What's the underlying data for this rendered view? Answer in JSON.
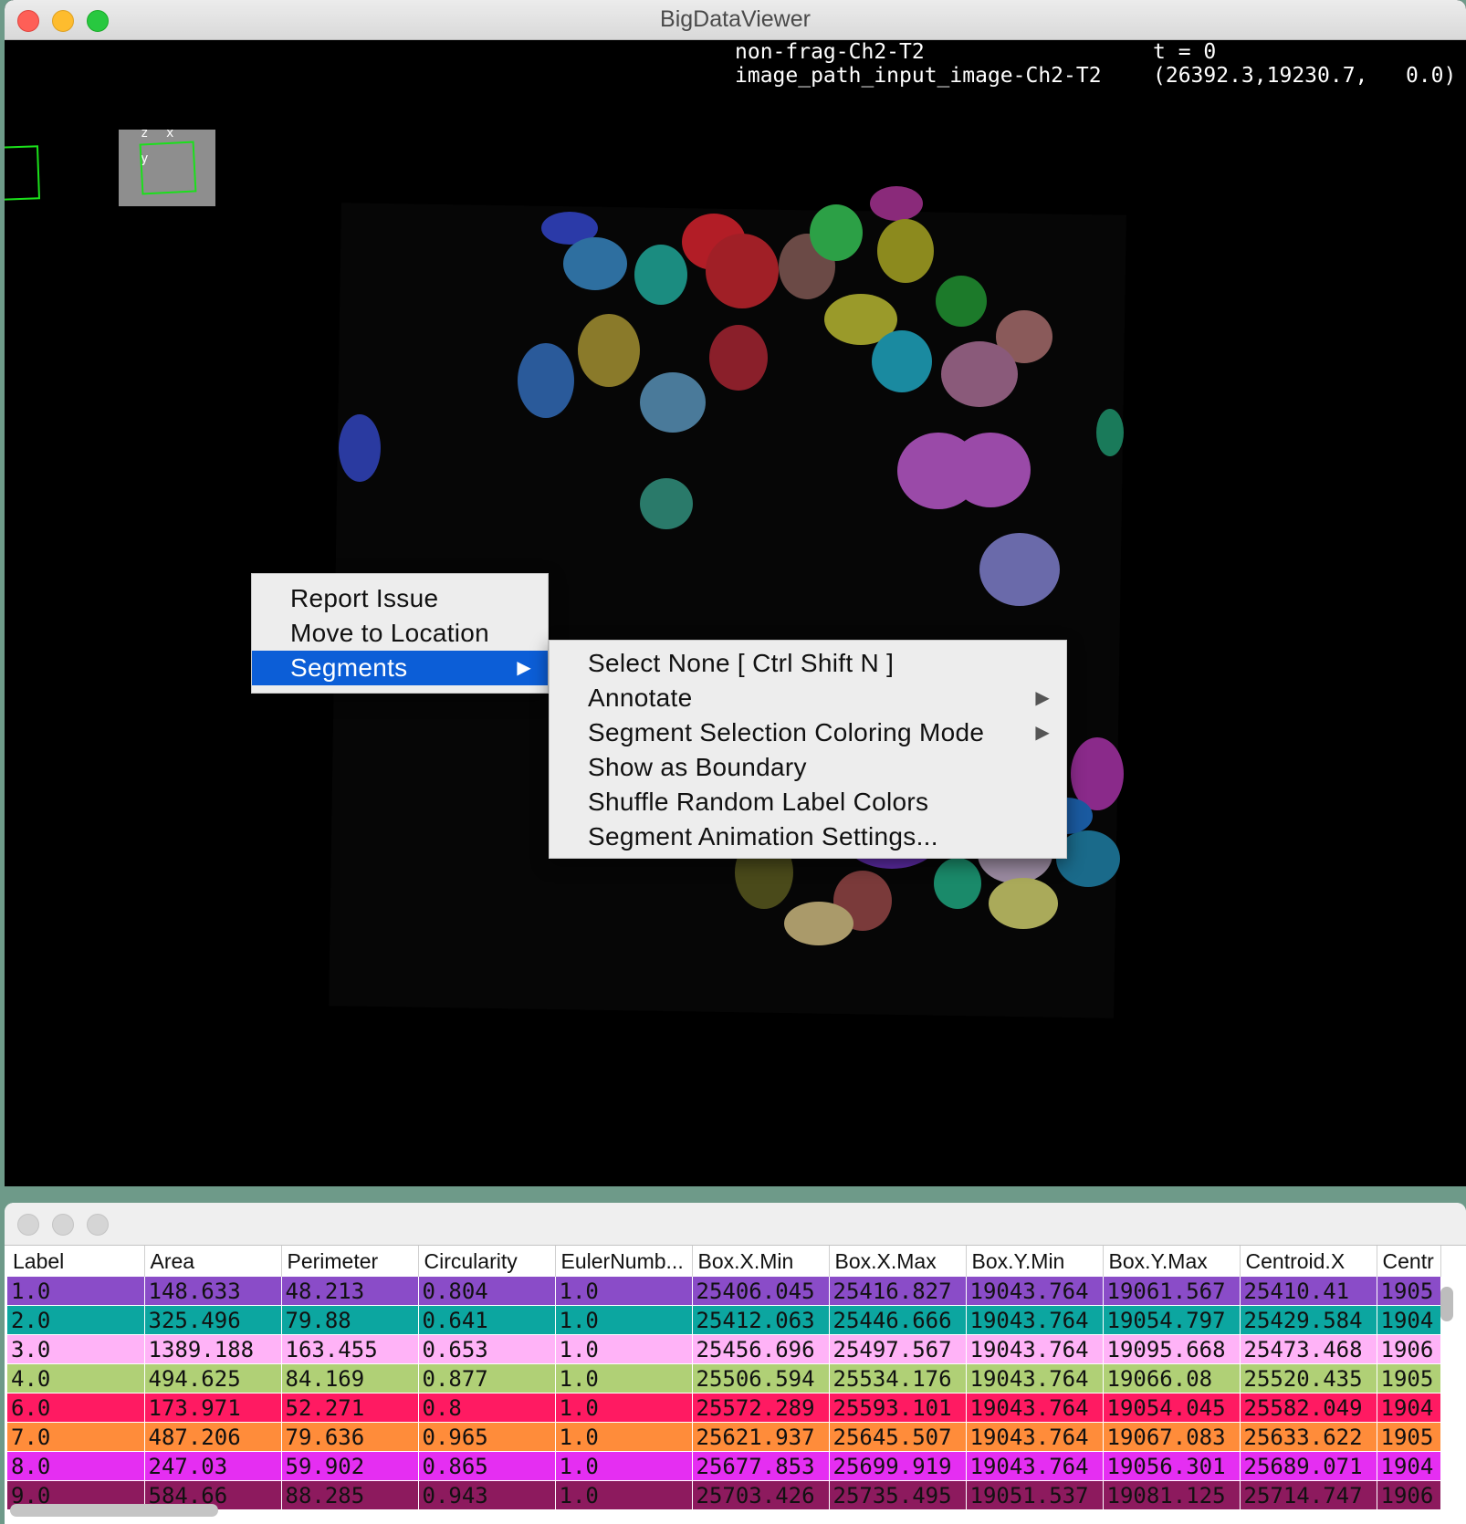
{
  "window": {
    "title": "BigDataViewer",
    "overlay": {
      "source_name": "non-frag-Ch2-T2",
      "image_name": "image_path_input_image-Ch2-T2",
      "time": "t = 0",
      "coordinates": "(26392.3,19230.7,   0.0)"
    },
    "axes_labels": {
      "z": "z",
      "x": "x",
      "y": "y"
    }
  },
  "context_menu": {
    "items": [
      "Report Issue",
      "Move to Location",
      "Segments"
    ],
    "selected": "Segments",
    "submenu": [
      {
        "label": "Select None [ Ctrl Shift N ]",
        "has_submenu": false
      },
      {
        "label": "Annotate",
        "has_submenu": true
      },
      {
        "label": "Segment Selection Coloring Mode",
        "has_submenu": true
      },
      {
        "label": "Show as Boundary",
        "has_submenu": false
      },
      {
        "label": "Shuffle Random Label Colors",
        "has_submenu": false
      },
      {
        "label": "Segment Animation Settings...",
        "has_submenu": false
      }
    ]
  },
  "table": {
    "columns": [
      "Label",
      "Area",
      "Perimeter",
      "Circularity",
      "EulerNumb...",
      "Box.X.Min",
      "Box.X.Max",
      "Box.Y.Min",
      "Box.Y.Max",
      "Centroid.X",
      "Centr"
    ],
    "rows": [
      {
        "color": "#8a4cc8",
        "cells": [
          "1.0",
          "148.633",
          "48.213",
          "0.804",
          "1.0",
          "25406.045",
          "25416.827",
          "19043.764",
          "19061.567",
          "25410.41",
          "1905"
        ]
      },
      {
        "color": "#0ca6a0",
        "cells": [
          "2.0",
          "325.496",
          "79.88",
          "0.641",
          "1.0",
          "25412.063",
          "25446.666",
          "19043.764",
          "19054.797",
          "25429.584",
          "1904"
        ]
      },
      {
        "color": "#ffb3f7",
        "cells": [
          "3.0",
          "1389.188",
          "163.455",
          "0.653",
          "1.0",
          "25456.696",
          "25497.567",
          "19043.764",
          "19095.668",
          "25473.468",
          "1906"
        ]
      },
      {
        "color": "#b0d076",
        "cells": [
          "4.0",
          "494.625",
          "84.169",
          "0.877",
          "1.0",
          "25506.594",
          "25534.176",
          "19043.764",
          "19066.08",
          "25520.435",
          "1905"
        ]
      },
      {
        "color": "#ff1a62",
        "cells": [
          "6.0",
          "173.971",
          "52.271",
          "0.8",
          "1.0",
          "25572.289",
          "25593.101",
          "19043.764",
          "19054.045",
          "25582.049",
          "1904"
        ]
      },
      {
        "color": "#ff8c3a",
        "cells": [
          "7.0",
          "487.206",
          "79.636",
          "0.965",
          "1.0",
          "25621.937",
          "25645.507",
          "19043.764",
          "19067.083",
          "25633.622",
          "1905"
        ]
      },
      {
        "color": "#e52ef2",
        "cells": [
          "8.0",
          "247.03",
          "59.902",
          "0.865",
          "1.0",
          "25677.853",
          "25699.919",
          "19043.764",
          "19056.301",
          "25689.071",
          "1904"
        ]
      },
      {
        "color": "#8d1a5e",
        "cells": [
          "9.0",
          "584.66",
          "88.285",
          "0.943",
          "1.0",
          "25703.426",
          "25735.495",
          "19051.537",
          "19081.125",
          "25714.747",
          "1906"
        ]
      }
    ]
  }
}
